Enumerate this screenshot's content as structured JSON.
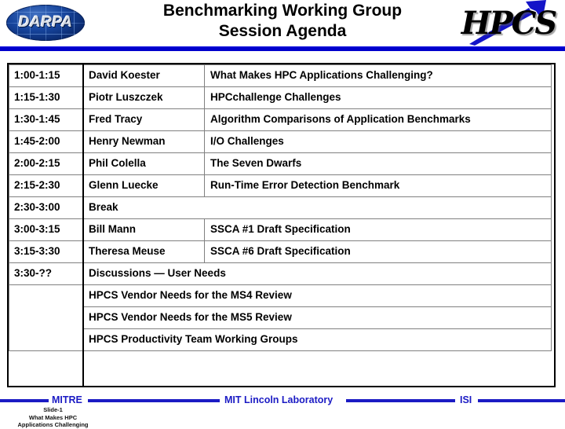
{
  "header": {
    "title_line1": "Benchmarking Working Group",
    "title_line2": "Session Agenda",
    "darpa_logo_text": "DARPA",
    "hpcs_logo_text": "HPCS",
    "rule_color": "#0000cc"
  },
  "agenda": {
    "rows": [
      {
        "time": "1:00-1:15",
        "name": "David Koester",
        "topic": "What Makes HPC Applications Challenging?",
        "span": false
      },
      {
        "time": "1:15-1:30",
        "name": "Piotr Luszczek",
        "topic": "HPCchallenge Challenges",
        "span": false
      },
      {
        "time": "1:30-1:45",
        "name": "Fred Tracy",
        "topic": "Algorithm Comparisons of Application Benchmarks",
        "span": false
      },
      {
        "time": "1:45-2:00",
        "name": "Henry Newman",
        "topic": "I/O Challenges",
        "span": false
      },
      {
        "time": "2:00-2:15",
        "name": "Phil Colella",
        "topic": "The Seven Dwarfs",
        "span": false
      },
      {
        "time": "2:15-2:30",
        "name": "Glenn Luecke",
        "topic": "Run-Time Error Detection Benchmark",
        "span": false
      },
      {
        "time": "2:30-3:00",
        "name": "Break",
        "topic": "",
        "span": true
      },
      {
        "time": "3:00-3:15",
        "name": "Bill Mann",
        "topic": "SSCA #1 Draft Specification",
        "span": false
      },
      {
        "time": "3:15-3:30",
        "name": "Theresa Meuse",
        "topic": "SSCA #6 Draft Specification",
        "span": false
      },
      {
        "time": "3:30-??",
        "name": "Discussions — User Needs",
        "topic": "",
        "span": true
      },
      {
        "time": "",
        "name": "HPCS Vendor Needs for the MS4 Review",
        "topic": "",
        "span": true
      },
      {
        "time": "",
        "name": "HPCS Vendor Needs for the MS5 Review",
        "topic": "",
        "span": true
      },
      {
        "time": "",
        "name": "HPCS Productivity Team Working Groups",
        "topic": "",
        "span": true
      }
    ]
  },
  "footer": {
    "labels": [
      "MITRE",
      "MIT Lincoln Laboratory",
      "ISI"
    ],
    "slide_number": "Slide-1",
    "note_line1": "What Makes HPC",
    "note_line2": "Applications Challenging",
    "line_color": "#1b1bc4"
  }
}
